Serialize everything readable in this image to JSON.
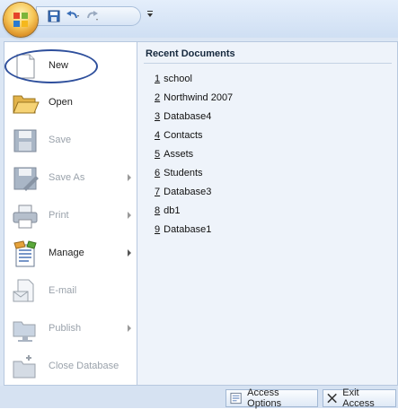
{
  "office_button": {
    "icon": "office-logo-icon"
  },
  "quick_access": {
    "save_icon": "save-icon",
    "undo_icon": "undo-icon",
    "redo_icon": "redo-icon",
    "customize_icon": "customize-dropdown-icon"
  },
  "menu": {
    "items": [
      {
        "label": "New",
        "icon": "new-document-icon",
        "enabled": true,
        "has_submenu": false
      },
      {
        "label": "Open",
        "icon": "open-folder-icon",
        "enabled": true,
        "has_submenu": false
      },
      {
        "label": "Save",
        "icon": "save-disk-icon",
        "enabled": false,
        "has_submenu": false
      },
      {
        "label": "Save As",
        "icon": "save-as-icon",
        "enabled": false,
        "has_submenu": true
      },
      {
        "label": "Print",
        "icon": "printer-icon",
        "enabled": false,
        "has_submenu": true
      },
      {
        "label": "Manage",
        "icon": "manage-icon",
        "enabled": true,
        "has_submenu": true
      },
      {
        "label": "E-mail",
        "icon": "email-icon",
        "enabled": false,
        "has_submenu": false
      },
      {
        "label": "Publish",
        "icon": "publish-icon",
        "enabled": false,
        "has_submenu": true
      },
      {
        "label": "Close Database",
        "icon": "close-database-icon",
        "enabled": false,
        "has_submenu": false
      }
    ]
  },
  "recent": {
    "title": "Recent Documents",
    "items": [
      {
        "num": "1",
        "name": "school"
      },
      {
        "num": "2",
        "name": "Northwind 2007"
      },
      {
        "num": "3",
        "name": "Database4"
      },
      {
        "num": "4",
        "name": "Contacts"
      },
      {
        "num": "5",
        "name": "Assets"
      },
      {
        "num": "6",
        "name": "Students"
      },
      {
        "num": "7",
        "name": "Database3"
      },
      {
        "num": "8",
        "name": "db1"
      },
      {
        "num": "9",
        "name": "Database1"
      }
    ]
  },
  "footer": {
    "options_label": "Access Options",
    "exit_label": "Exit Access"
  },
  "colors": {
    "accent": "#2e4f9c",
    "disabled_text": "#9aa2ab"
  }
}
